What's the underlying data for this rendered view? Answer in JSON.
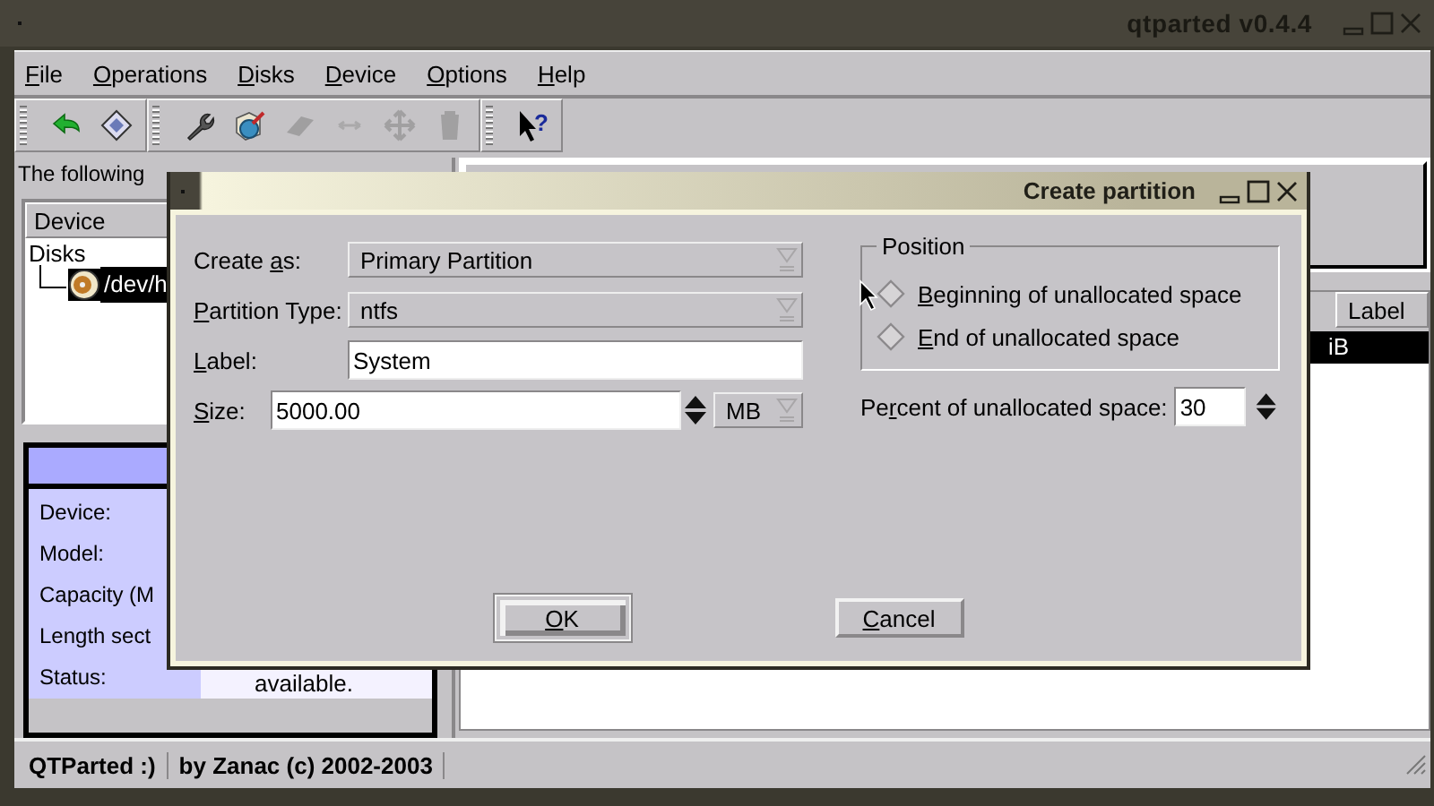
{
  "window": {
    "title": "qtparted v0.4.4"
  },
  "menu": [
    {
      "label": {
        "key": "F",
        "after": "ile"
      }
    },
    {
      "label": {
        "key": "O",
        "after": "perations"
      }
    },
    {
      "label": {
        "key": "D",
        "after": "isks"
      }
    },
    {
      "label": {
        "key": "D",
        "after": "evice"
      }
    },
    {
      "label": {
        "key": "O",
        "after": "ptions"
      }
    },
    {
      "label": {
        "key": "H",
        "after": "elp"
      }
    }
  ],
  "toolbar": [
    {
      "icons": [
        {
          "kind": "undo",
          "disabled": false
        },
        {
          "kind": "commit",
          "disabled": false
        }
      ]
    },
    {
      "icons": [
        {
          "kind": "wrench",
          "disabled": false
        },
        {
          "kind": "create",
          "disabled": false
        },
        {
          "kind": "erase",
          "disabled": true
        },
        {
          "kind": "resize",
          "disabled": true
        },
        {
          "kind": "move",
          "disabled": true
        },
        {
          "kind": "delete",
          "disabled": true
        }
      ]
    },
    {
      "icons": [
        {
          "kind": "whatsthis",
          "disabled": false,
          "glyph": "?"
        }
      ]
    }
  ],
  "drives": {
    "caption": "The following",
    "column": "Device",
    "tree": [
      {
        "label": "Disks",
        "selected": false,
        "children": [
          {
            "label": "/dev/h",
            "selected": true
          }
        ]
      }
    ]
  },
  "info": {
    "rows": [
      {
        "label": "Device:"
      },
      {
        "label": "Model:"
      },
      {
        "label": "Capacity (M"
      },
      {
        "label": "Length sect"
      },
      {
        "label": "Status:",
        "value": "available."
      }
    ]
  },
  "partitions": {
    "column": "Label",
    "row": {
      "cell": "iB",
      "selected": true
    }
  },
  "status_bar": [
    "QTParted :)",
    "by Zanac (c) 2002-2003"
  ],
  "dialog": {
    "title": "Create partition",
    "fields": [
      {
        "kind": "combo",
        "label": {
          "before": "Create ",
          "key": "a",
          "after": "s:"
        },
        "value": "Primary Partition"
      },
      {
        "kind": "combo",
        "label": {
          "key": "P",
          "after": "artition Type:"
        },
        "value": "ntfs"
      },
      {
        "kind": "text",
        "label": {
          "key": "L",
          "after": "abel:"
        },
        "value": "System"
      },
      {
        "kind": "spin",
        "label": {
          "key": "S",
          "after": "ize:"
        },
        "value": "5000.00",
        "unit": "MB"
      }
    ],
    "position": {
      "title": "Position",
      "options": [
        {
          "label": {
            "key": "B",
            "after": "eginning of unallocated space"
          },
          "selected": false
        },
        {
          "label": {
            "key": "E",
            "after": "nd of unallocated space"
          },
          "selected": false
        }
      ]
    },
    "percent": {
      "label": {
        "before": "Pe",
        "key": "r",
        "after": "cent of unallocated space:"
      },
      "value": "30"
    },
    "buttons": [
      {
        "label": {
          "key": "O",
          "after": "K"
        },
        "default": true
      },
      {
        "label": {
          "key": "C",
          "after": "ancel"
        },
        "default": false
      }
    ]
  }
}
